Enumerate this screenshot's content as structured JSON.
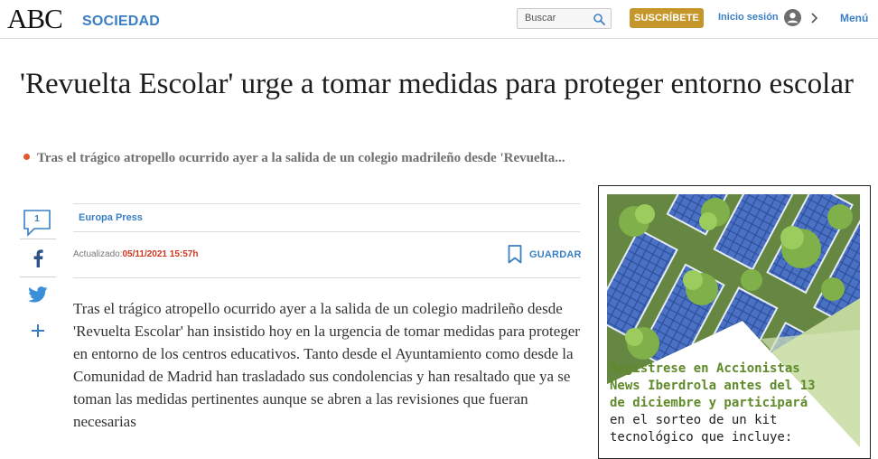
{
  "header": {
    "logo": "ABC",
    "section": "SOCIEDAD",
    "search_placeholder": "Buscar",
    "subscribe_label": "SUSCRÍBETE",
    "login_label": "Inicio sesión",
    "menu_label": "Menú"
  },
  "article": {
    "title": "'Revuelta Escolar' urge a tomar medidas para proteger entorno escolar",
    "subtitle": "Tras el trágico atropello ocurrido ayer a la salida de un colegio madrileño desde 'Revuelta...",
    "author": "Europa Press",
    "updated_label": "Actualizado:",
    "updated_date": "05/11/2021 15:57h",
    "save_label": "GUARDAR",
    "comments_count": "1",
    "body": "Tras el trágico atropello ocurrido ayer a la salida de un colegio madrileño desde 'Revuelta Escolar' han insistido hoy en la urgencia de tomar medidas para proteger en entorno de los centros educativos. Tanto desde el Ayuntamiento como desde la Comunidad de Madrid han trasladado sus condolencias y han resaltado que ya se toman las medidas pertinentes aunque se abren a las revisiones que fueran necesarias"
  },
  "share": {
    "icons": [
      "comment-icon",
      "facebook-icon",
      "twitter-icon",
      "plus-icon"
    ]
  },
  "ad": {
    "highlight": "Regístrese en Accionistas News Iberdrola antes del 13 de diciembre y participará",
    "text": "en el sorteo de un kit tecnológico que incluye:"
  },
  "colors": {
    "accent": "#3a7fc4",
    "subscribe": "#c5962a",
    "date": "#d2361f",
    "bullet": "#e0582c",
    "ad_green": "#5f8a2a"
  }
}
